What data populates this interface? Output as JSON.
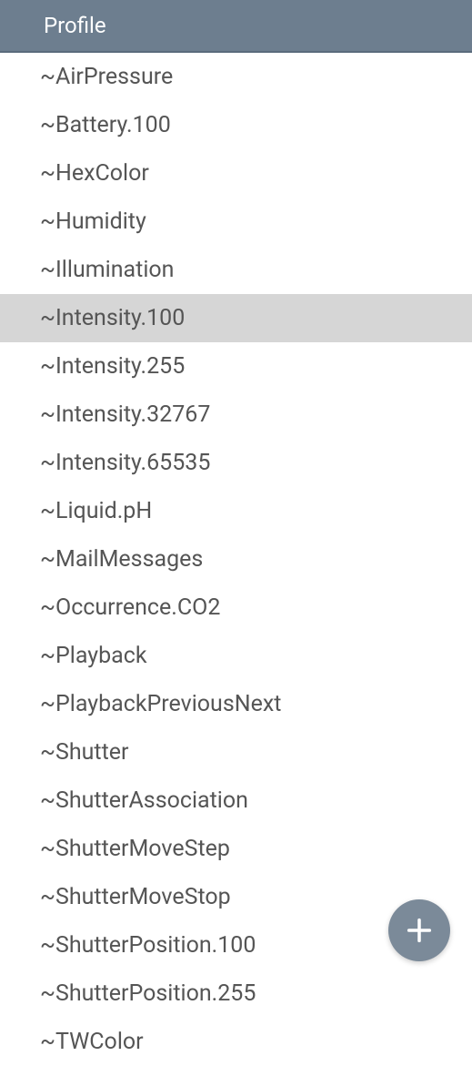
{
  "header": {
    "title": "Profile"
  },
  "list": {
    "items": [
      {
        "label": "~AirPressure",
        "selected": false
      },
      {
        "label": "~Battery.100",
        "selected": false
      },
      {
        "label": "~HexColor",
        "selected": false
      },
      {
        "label": "~Humidity",
        "selected": false
      },
      {
        "label": "~Illumination",
        "selected": false
      },
      {
        "label": "~Intensity.100",
        "selected": true
      },
      {
        "label": "~Intensity.255",
        "selected": false
      },
      {
        "label": "~Intensity.32767",
        "selected": false
      },
      {
        "label": "~Intensity.65535",
        "selected": false
      },
      {
        "label": "~Liquid.pH",
        "selected": false
      },
      {
        "label": "~MailMessages",
        "selected": false
      },
      {
        "label": "~Occurrence.CO2",
        "selected": false
      },
      {
        "label": "~Playback",
        "selected": false
      },
      {
        "label": "~PlaybackPreviousNext",
        "selected": false
      },
      {
        "label": "~Shutter",
        "selected": false
      },
      {
        "label": "~ShutterAssociation",
        "selected": false
      },
      {
        "label": "~ShutterMoveStep",
        "selected": false
      },
      {
        "label": "~ShutterMoveStop",
        "selected": false
      },
      {
        "label": "~ShutterPosition.100",
        "selected": false
      },
      {
        "label": "~ShutterPosition.255",
        "selected": false
      },
      {
        "label": "~TWColor",
        "selected": false
      }
    ]
  },
  "fab": {
    "icon": "plus-icon"
  }
}
